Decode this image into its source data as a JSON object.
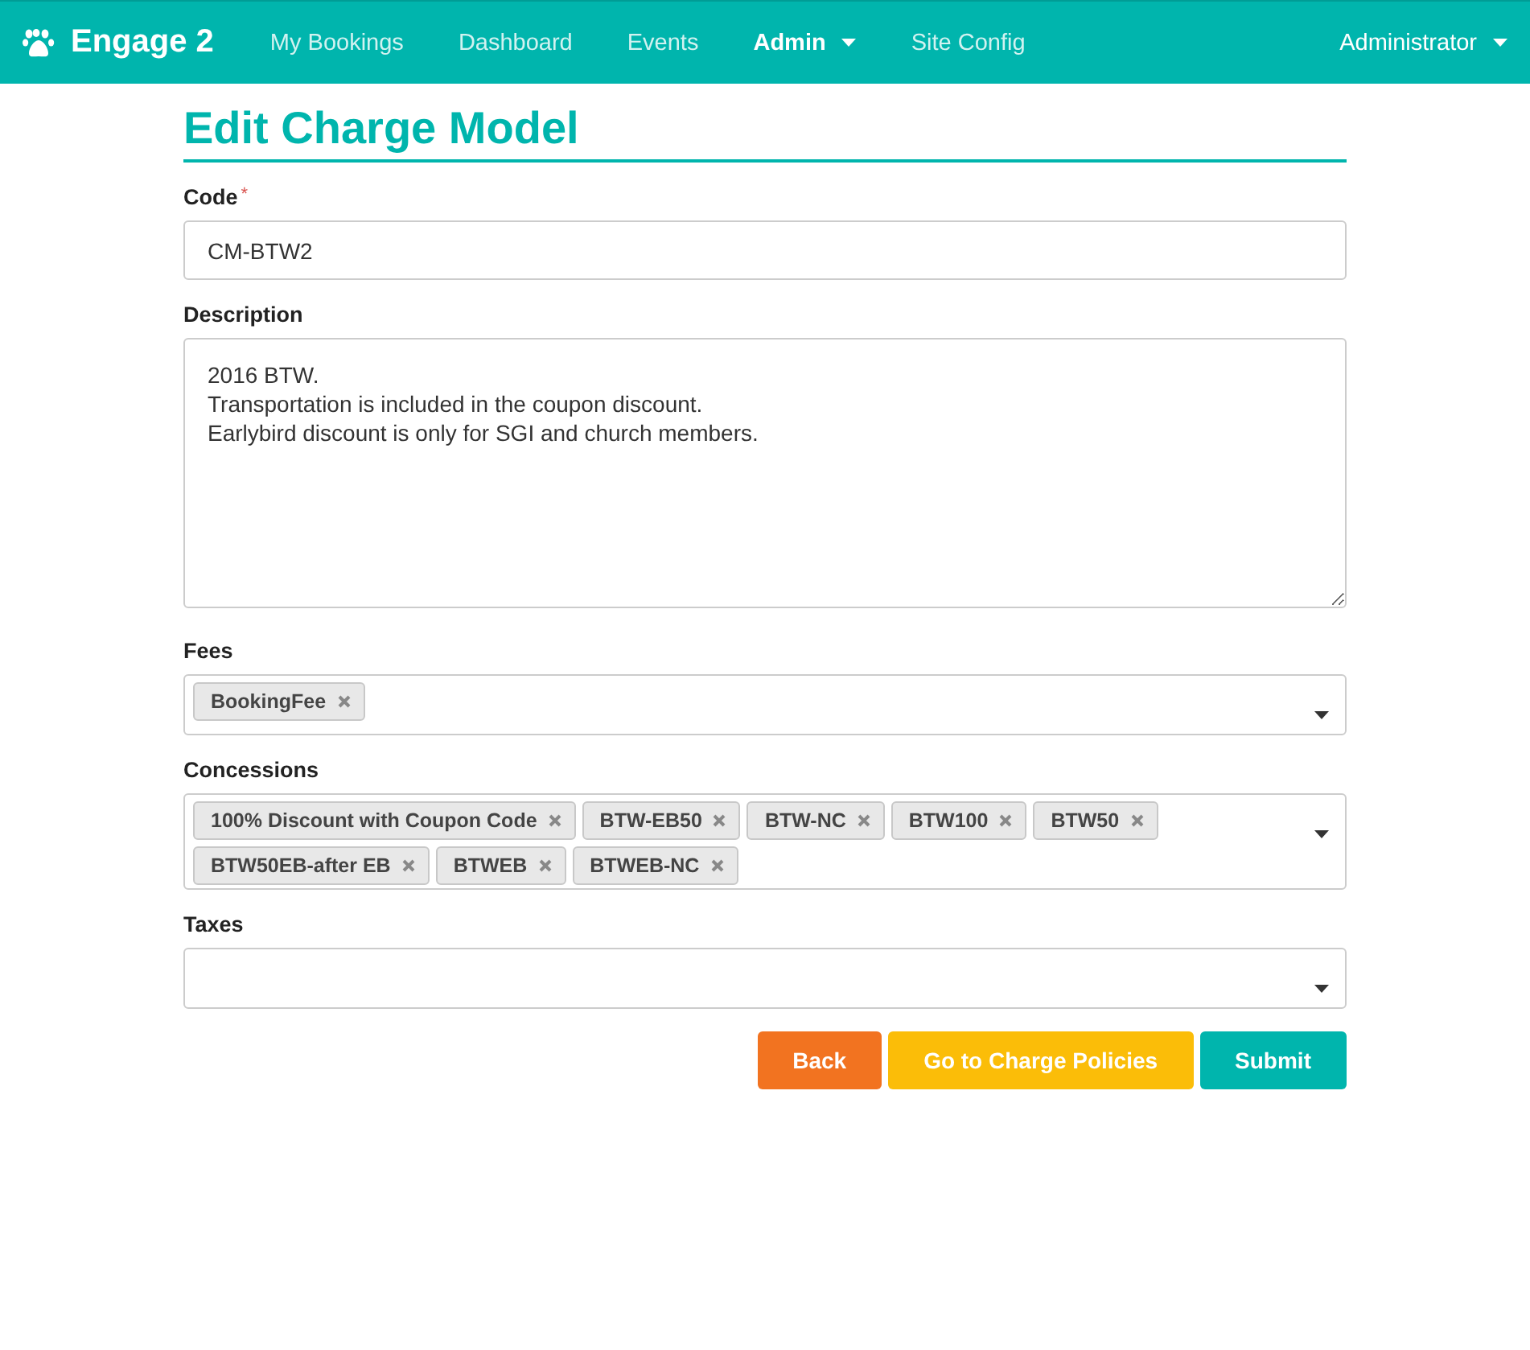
{
  "navbar": {
    "brand": "Engage 2",
    "items": [
      {
        "label": "My Bookings",
        "selected": false,
        "dropdown": false
      },
      {
        "label": "Dashboard",
        "selected": false,
        "dropdown": false
      },
      {
        "label": "Events",
        "selected": false,
        "dropdown": false
      },
      {
        "label": "Admin",
        "selected": true,
        "dropdown": true
      },
      {
        "label": "Site Config",
        "selected": false,
        "dropdown": false
      }
    ],
    "user": {
      "label": "Administrator",
      "dropdown": true
    }
  },
  "page": {
    "title": "Edit Charge Model"
  },
  "fields": [
    {
      "kind": "text",
      "label": "Code",
      "required_mark": "*",
      "value": "CM-BTW2"
    },
    {
      "kind": "textarea",
      "label": "Description",
      "value": "2016 BTW.\nTransportation is included in the coupon discount.\nEarlybird discount is only for SGI and church members."
    },
    {
      "kind": "multiselect",
      "label": "Fees",
      "tags": [
        "BookingFee"
      ]
    },
    {
      "kind": "multiselect",
      "label": "Concessions",
      "tags": [
        "100% Discount with Coupon Code",
        "BTW-EB50",
        "BTW-NC",
        "BTW100",
        "BTW50",
        "BTW50EB-after EB",
        "BTWEB",
        "BTWEB-NC"
      ]
    },
    {
      "kind": "multiselect",
      "label": "Taxes"
    }
  ],
  "buttons": [
    {
      "kind": "back",
      "label": "Back"
    },
    {
      "kind": "warning",
      "label": "Go to Charge Policies"
    },
    {
      "kind": "primary",
      "label": "Submit"
    }
  ]
}
